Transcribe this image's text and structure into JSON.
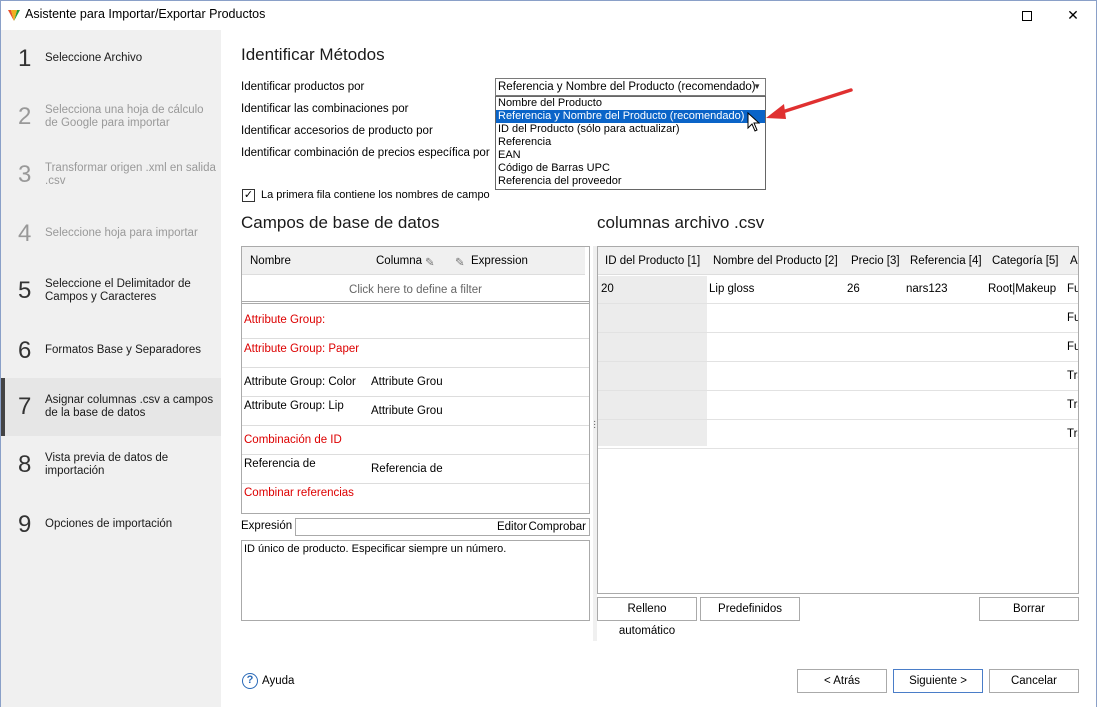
{
  "window": {
    "title": "Asistente para Importar/Exportar Productos",
    "maximize_icon": "maximize-icon",
    "close_icon": "close-icon",
    "close_glyph": "✕"
  },
  "sidebar": {
    "steps": [
      {
        "num": "1",
        "label": "Seleccione Archivo",
        "state": "normal"
      },
      {
        "num": "2",
        "label": "Selecciona una hoja de cálculo de Google para importar",
        "state": "dim"
      },
      {
        "num": "3",
        "label": "Transformar origen .xml en salida .csv",
        "state": "dim"
      },
      {
        "num": "4",
        "label": "Seleccione hoja para importar",
        "state": "dim"
      },
      {
        "num": "5",
        "label": "Seleccione el Delimitador de Campos y Caracteres",
        "state": "normal"
      },
      {
        "num": "6",
        "label": "Formatos Base y Separadores",
        "state": "normal"
      },
      {
        "num": "7",
        "label": "Asignar columnas .csv a campos de la base de datos",
        "state": "active"
      },
      {
        "num": "8",
        "label": "Vista previa de datos de importación",
        "state": "normal"
      },
      {
        "num": "9",
        "label": "Opciones de importación",
        "state": "normal"
      }
    ]
  },
  "methods": {
    "title": "Identificar Métodos",
    "identify_products_label": "Identificar productos por",
    "identify_combinations_label": "Identificar las combinaciones por",
    "identify_accessories_label": "Identificar accesorios de producto por",
    "identify_price_combo_label": "Identificar combinación de precios específica por",
    "combo_value": "Referencia y Nombre del Producto (recomendado)",
    "options": [
      "Nombre del Producto",
      "Referencia y Nombre del Producto (recomendado)",
      "ID del Producto (sólo para actualizar)",
      "Referencia",
      "EAN",
      "Código de Barras UPC",
      "Referencia del proveedor"
    ],
    "selected_index": 1,
    "first_row_label": "La primera fila contiene los nombres de campo",
    "first_row_checked": true
  },
  "db_fields": {
    "title": "Campos de base de datos",
    "col_name": "Nombre",
    "col_column": "Columna",
    "col_expression": "Expression",
    "filter_text": "Click here to define a filter",
    "rows": [
      {
        "name": "Attribute Group:",
        "column": "",
        "red": true
      },
      {
        "name": "Attribute Group: Paper",
        "column": "",
        "red": true
      },
      {
        "name": "Attribute Group: Color",
        "column": "Attribute Grou",
        "red": false
      },
      {
        "name": "Attribute Group: Lip",
        "column": "Attribute Grou",
        "red": false
      },
      {
        "name": "Combinación de ID",
        "column": "",
        "red": true
      },
      {
        "name": "Referencia de",
        "column": "Referencia de",
        "red": false
      },
      {
        "name": "Combinar referencias",
        "column": "",
        "red": true
      }
    ],
    "expression_label": "Expresión",
    "editor_label": "Editor",
    "test_label": "Comprobar",
    "description": "ID único de producto. Especificar siempre un número."
  },
  "csv": {
    "title": "columnas archivo .csv",
    "headers": [
      "ID del Producto [1]",
      "Nombre del Producto [2]",
      "Precio [3]",
      "Referencia [4]",
      "Categoría [5]",
      "A"
    ],
    "rows": [
      [
        "20",
        "Lip gloss",
        "26",
        "nars123",
        "Root|Makeup",
        "Fu"
      ],
      [
        "",
        "",
        "",
        "",
        "",
        "Fu"
      ],
      [
        "",
        "",
        "",
        "",
        "",
        "Fu"
      ],
      [
        "",
        "",
        "",
        "",
        "",
        "Tra"
      ],
      [
        "",
        "",
        "",
        "",
        "",
        "Tra"
      ],
      [
        "",
        "",
        "",
        "",
        "",
        "Tra"
      ]
    ],
    "autofill_label": "Relleno automático",
    "predefined_label": "Predefinidos",
    "clear_label": "Borrar"
  },
  "footer": {
    "help_label": "Ayuda",
    "back_label": "< Atrás",
    "next_label": "Siguiente >",
    "cancel_label": "Cancelar"
  },
  "colors": {
    "accent": "#0a64c8",
    "required_field": "#dd0000",
    "pointer_arrow": "#e03030"
  }
}
